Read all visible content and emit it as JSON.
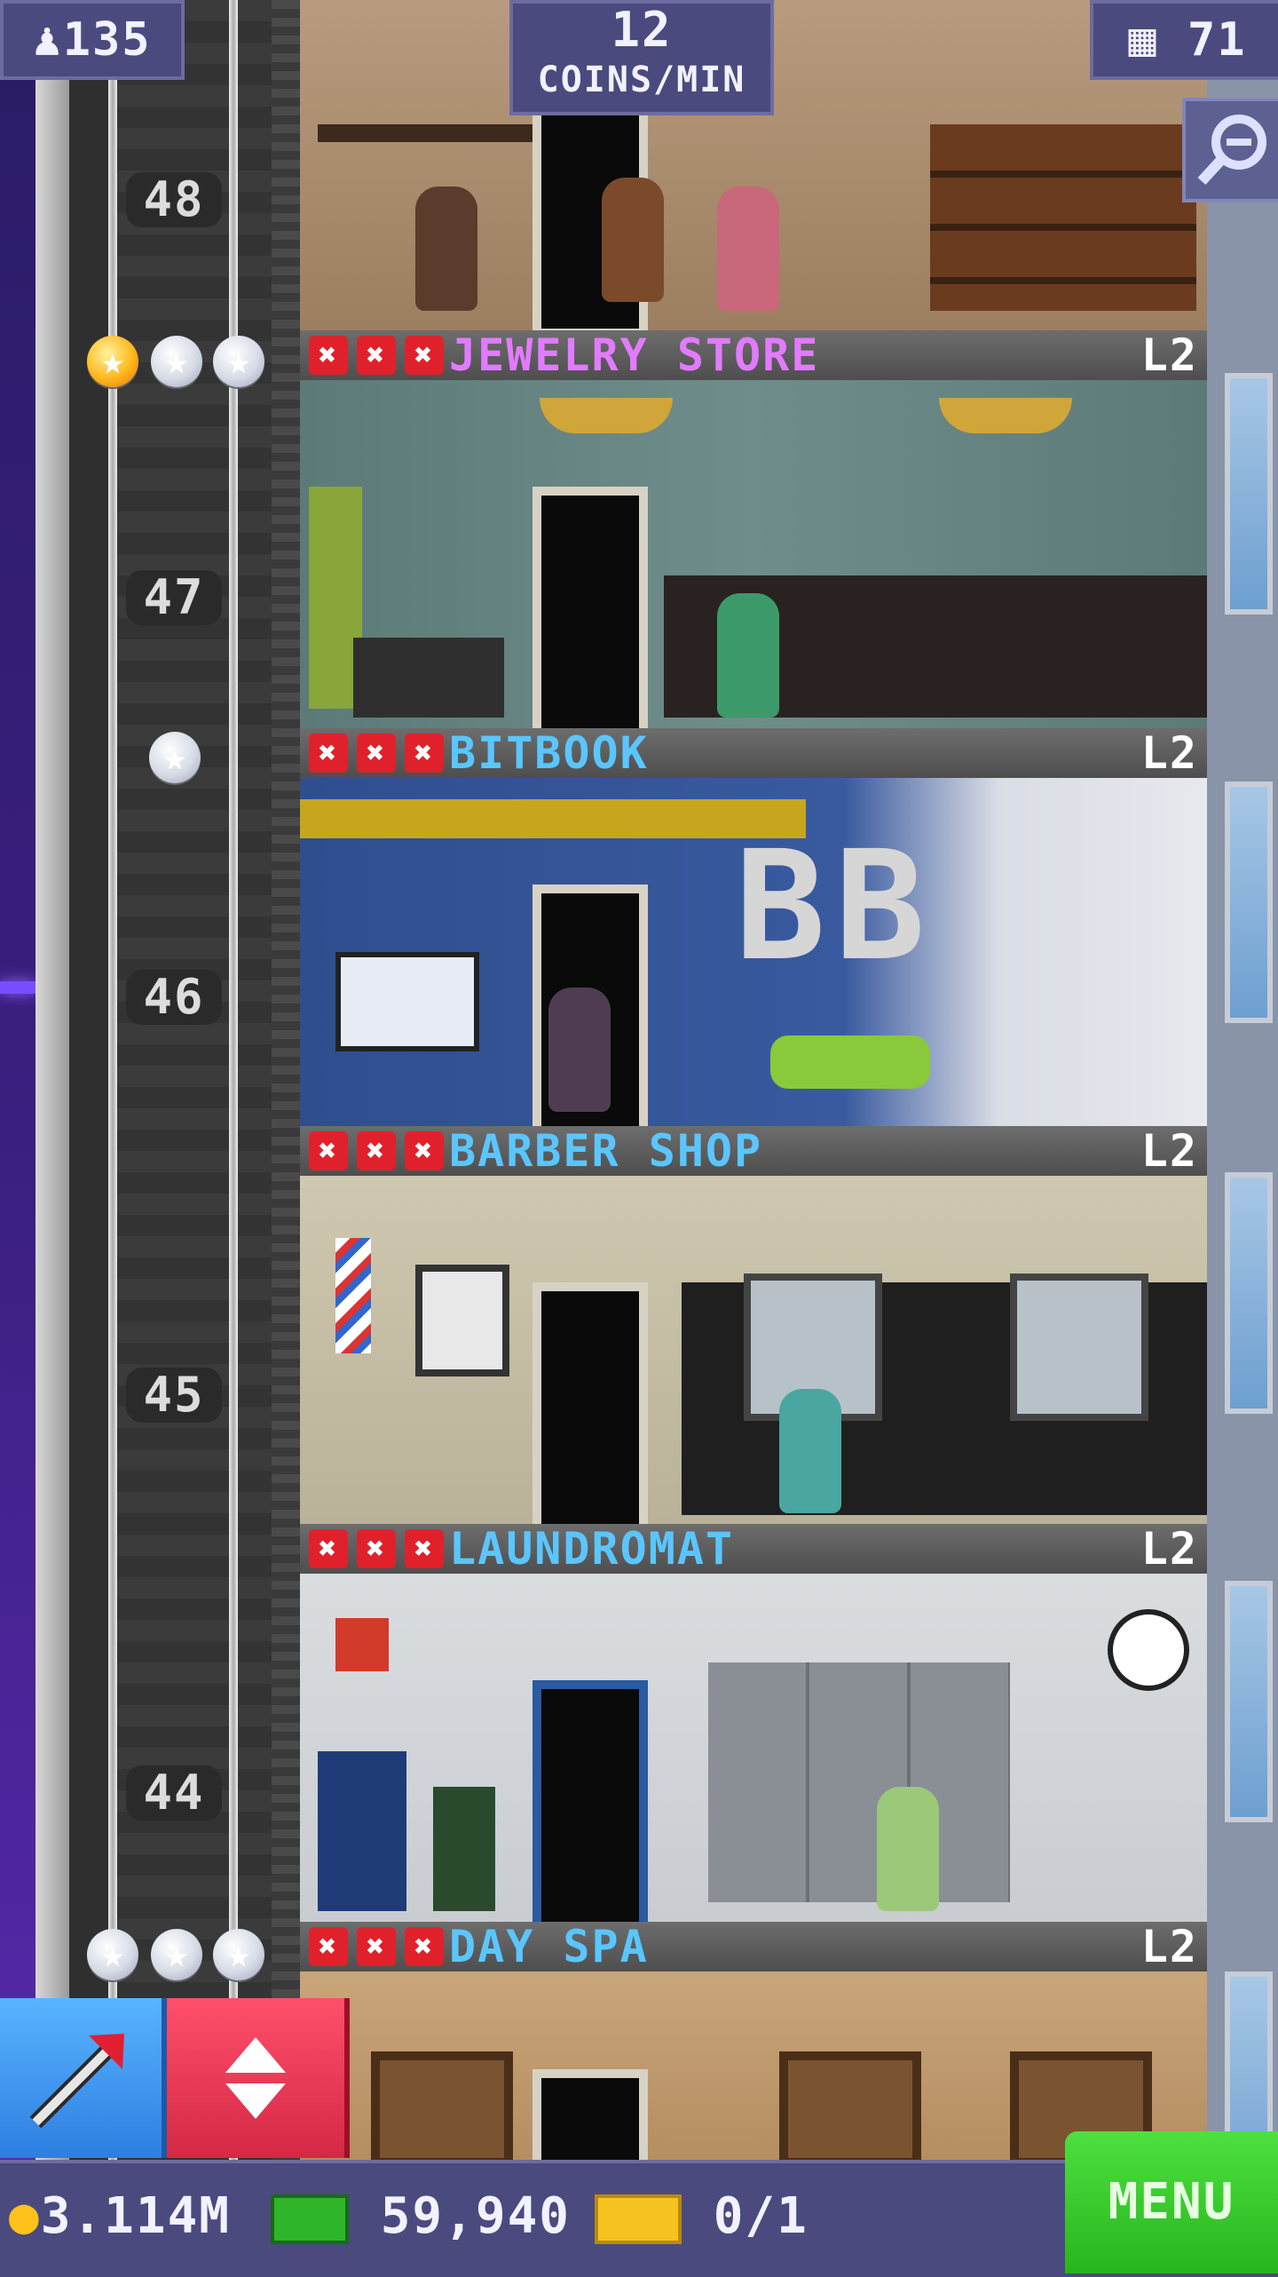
{
  "hud": {
    "population": "135",
    "coins_rate": "12",
    "coins_rate_unit": "COINS/MIN",
    "floors_count": "71",
    "population_icon": "person-icon",
    "floors_icon": "building-icon",
    "zoom_icon": "zoom-out-icon"
  },
  "shaft_floors": [
    "48",
    "47",
    "46",
    "45",
    "44"
  ],
  "floors": [
    {
      "name": "JEWELRY STORE",
      "level": "L2",
      "name_color": "#e27bff"
    },
    {
      "name": "BITBOOK",
      "level": "L2",
      "name_color": "#5ac6ff"
    },
    {
      "name": "BARBER SHOP",
      "level": "L2",
      "name_color": "#5ac6ff"
    },
    {
      "name": "LAUNDROMAT",
      "level": "L2",
      "name_color": "#5ac6ff"
    },
    {
      "name": "DAY SPA",
      "level": "L2",
      "name_color": "#5ac6ff"
    }
  ],
  "bitbook_logo": "BB",
  "bottom": {
    "coins": "3.114M",
    "bux": "59,940",
    "tickets": "0/1",
    "menu_label": "MENU",
    "coin_icon": "coin-icon",
    "bux_icon": "bux-icon",
    "ticket_icon": "ticket-icon",
    "up_button_icon": "up-arrow-icon",
    "elevator_button_icon": "elevator-updown-icon"
  },
  "colors": {
    "hud_bg": "#4b4a7e",
    "menu_green": "#33c028",
    "stop_red": "#e0212b"
  }
}
